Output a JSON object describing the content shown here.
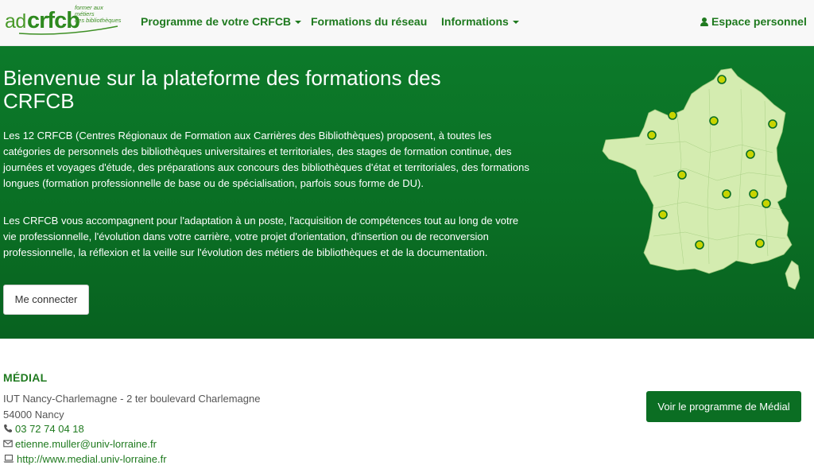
{
  "brand": {
    "logo_prefix": "ad",
    "logo_main": "crfcb",
    "logo_tagline_1": "former aux métiers",
    "logo_tagline_2": "des bibliothèques"
  },
  "nav": {
    "programme": "Programme de votre CRFCB",
    "formations": "Formations du réseau",
    "informations": "Informations",
    "espace": "Espace personnel"
  },
  "hero": {
    "title": "Bienvenue sur la plateforme des formations des CRFCB",
    "paragraph1": "Les 12 CRFCB (Centres Régionaux de Formation aux Carrières des Bibliothèques) proposent, à toutes les catégories de personnels des bibliothèques universitaires et territoriales, des stages de formation continue, des journées et voyages d'étude, des préparations aux concours des bibliothèques d'état et territoriales, des formations longues (formation professionnelle de base ou de spécialisation, parfois sous forme de DU).",
    "paragraph2": "Les CRFCB vous accompagnent pour l'adaptation à un poste, l'acquisition de compétences tout au long de votre vie professionnelle, l'évolution dans votre carrière, votre projet d'orientation, d'insertion ou de reconversion professionnelle, la réflexion et la veille sur l'évolution des métiers de bibliothèques et de la documentation.",
    "login_button": "Me connecter"
  },
  "centre": {
    "name": "MÉDIAL",
    "address_line1": "IUT Nancy-Charlemagne - 2 ter boulevard Charlemagne",
    "address_line2": "54000 Nancy",
    "phone": "03 72 74 04 18",
    "email": "etienne.muller@univ-lorraine.fr",
    "website": "http://www.medial.univ-lorraine.fr",
    "program_button": "Voir le programme de Médial"
  },
  "colors": {
    "brand_green": "#1f7a1f",
    "hero_green": "#0b7228",
    "map_fill": "#d4ecb0",
    "marker": "#c8d400"
  },
  "icons": [
    "user-icon",
    "phone-icon",
    "envelope-icon",
    "laptop-icon",
    "caret-down-icon"
  ]
}
